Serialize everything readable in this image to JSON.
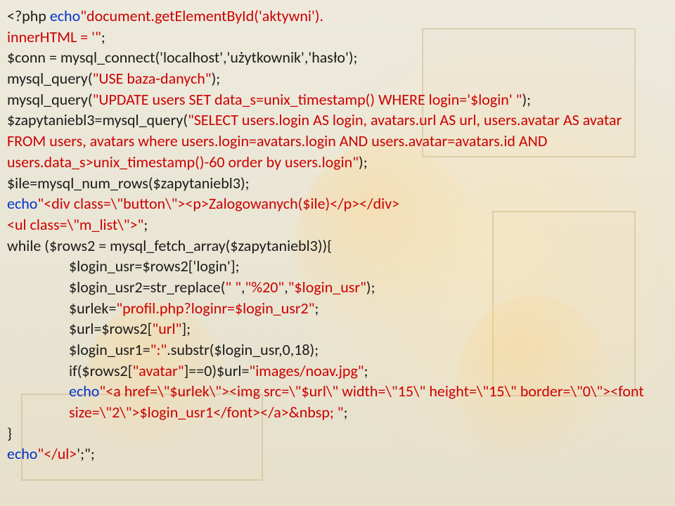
{
  "code": {
    "l1a": "<?php ",
    "l1b": "echo",
    "l1c": "\"document.getElementById('aktywni').",
    "l2a": "innerHTML = '\"",
    "l2b": ";",
    "l3": "$conn = mysql_connect('localhost','użytkownik','hasło');",
    "l4a": "mysql_query(",
    "l4b": "\"USE baza-danych\"",
    "l4c": ");",
    "l5a": "mysql_query(",
    "l5b": "\"UPDATE users SET data_s=unix_timestamp() WHERE login='$login' \"",
    "l5c": ");",
    "l6a": "$zapytaniebl3=mysql_query(",
    "l6b": "\"SELECT users.login AS login, avatars.url AS url, users.avatar AS avatar  FROM users, avatars where users.login=avatars.login AND users.avatar=avatars.id AND users.data_s>unix_timestamp()-60 order by users.login\"",
    "l6c": ");",
    "l7": "$ile=mysql_num_rows($zapytaniebl3);",
    "l8a": "echo",
    "l8b": "\"<div class=\\\"button\\\"><p>Zalogowanych($ile)</p></div>",
    "l9a": "<ul class=\\\"m_list\\\">\"",
    "l9b": ";",
    "l10": "while ($rows2 = mysql_fetch_array($zapytaniebl3)){",
    "l11": "$login_usr=$rows2['login'];",
    "l12a": "$login_usr2=str_replace(",
    "l12b": "\" \"",
    "l12c": ",",
    "l12d": "\"%20\"",
    "l12e": ",",
    "l12f": "\"$login_usr\"",
    "l12g": ");",
    "l13a": "$urlek=",
    "l13b": "\"profil.php?loginr=$login_usr2\"",
    "l13c": ";",
    "l14a": "$url=$rows2[",
    "l14b": "\"url\"",
    "l14c": "];",
    "l15a": "$login_usr1=",
    "l15b": "\":\"",
    "l15c": ".substr($login_usr,0,18);",
    "l16a": "if($rows2[",
    "l16b": "\"avatar\"",
    "l16c": "]==0)$url=",
    "l16d": "\"images/noav.jpg\"",
    "l16e": ";",
    "l17a": "echo",
    "l17b": "\"<a href=\\\"$urlek\\\"><img src=\\\"$url\\\" width=\\\"15\\\" height=\\\"15\\\" border=\\\"0\\\"><font size=\\\"2\\\">$login_usr1</font></a>&nbsp; \"",
    "l17c": ";",
    "l18": "}",
    "l19a": "echo",
    "l19b": "\"</ul>",
    "l19c": "';\";"
  }
}
